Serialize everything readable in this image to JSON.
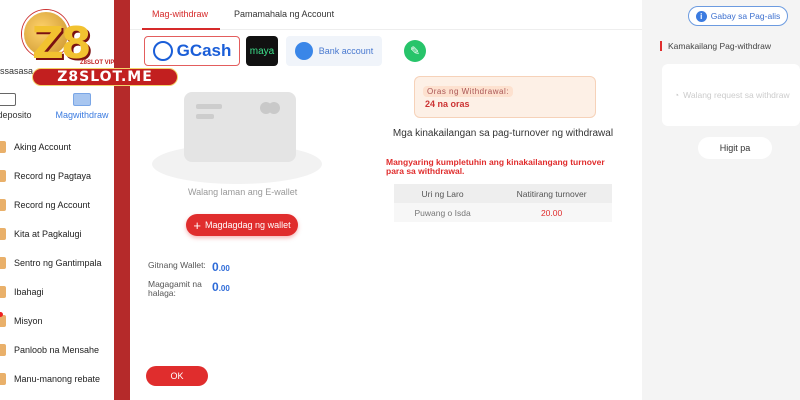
{
  "logo": {
    "text": "Z8",
    "badge": "Z8SLOT.ME",
    "tagline": "Z8SLOT VIP"
  },
  "user": {
    "name": "ssasasa"
  },
  "top_actions": [
    {
      "label": "gdeposito",
      "icon": "wallet-icon"
    },
    {
      "label": "Magwithdraw",
      "icon": "card-icon"
    }
  ],
  "menu": [
    {
      "label": "Aking Account"
    },
    {
      "label": "Record ng Pagtaya"
    },
    {
      "label": "Record ng Account"
    },
    {
      "label": "Kita at Pagkalugi"
    },
    {
      "label": "Sentro ng Gantimpala"
    },
    {
      "label": "Ibahagi"
    },
    {
      "label": "Misyon"
    },
    {
      "label": "Panloob na Mensahe"
    },
    {
      "label": "Manu-manong rebate"
    }
  ],
  "tabs": {
    "withdraw": "Mag-withdraw",
    "account": "Pamamahala ng Account"
  },
  "methods": {
    "gcash": "GCash",
    "maya": "maya",
    "bank": "Bank account"
  },
  "wallet": {
    "empty_text": "Walang laman ang E-wallet",
    "add_button": "Magdagdag ng wallet"
  },
  "balances": {
    "center_label": "Gitnang Wallet:",
    "center_value": "0",
    "center_decimals": ".00",
    "usable_label": "Magagamit na halaga:",
    "usable_value": "0",
    "usable_decimals": ".00"
  },
  "ok_button": "OK",
  "turnover": {
    "time_label": "Oras ng Withdrawal:",
    "time_value": "24 na oras",
    "requirement_title": "Mga kinakailangan sa pag-turnover ng withdrawal",
    "warning": "Mangyaring kumpletuhin ang kinakailangang turnover para sa withdrawal.",
    "table": {
      "headers": [
        "Uri ng Laro",
        "Natitirang turnover"
      ],
      "rows": [
        [
          "Puwang o Isda",
          "20.00"
        ]
      ]
    }
  },
  "right_panel": {
    "guide_button": "Gabay sa Pag-alis",
    "recent_title": "Kamakailang Pag-withdraw",
    "recent_empty": "Walang request sa withdraw",
    "more_button": "Higit pa"
  },
  "colors": {
    "accent": "#e02d2d",
    "blue": "#2e6bd8",
    "sidebar_bg": "#8a1a1a"
  }
}
